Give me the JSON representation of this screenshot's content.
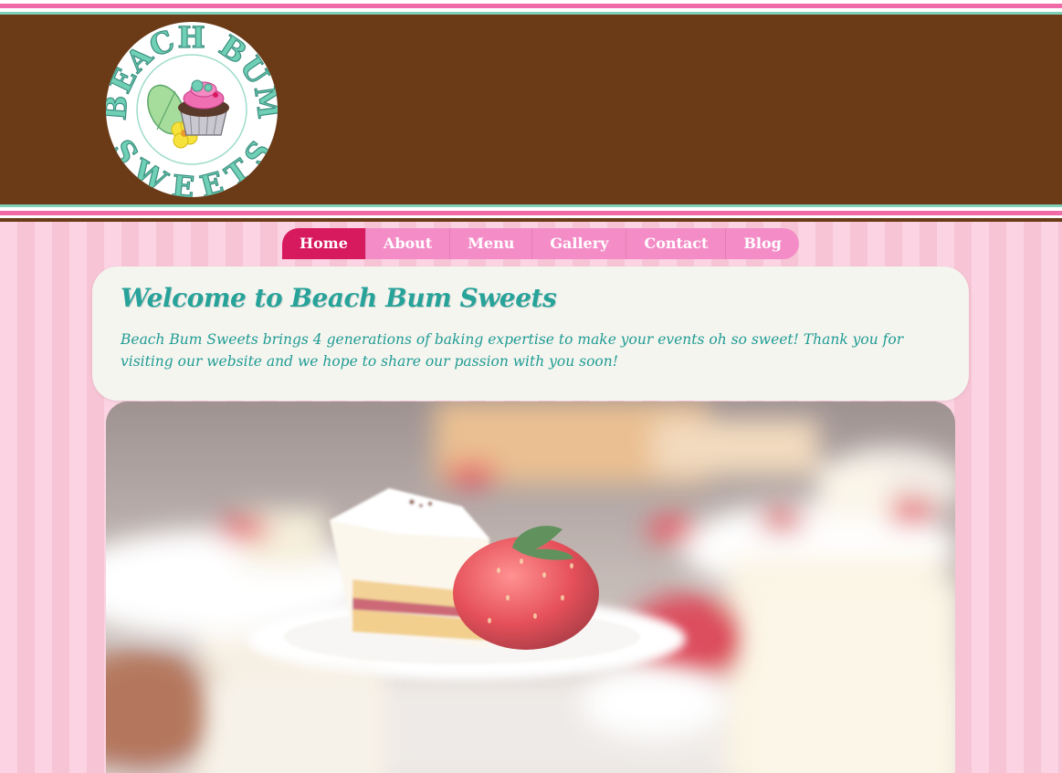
{
  "brand": {
    "logo_top_text": "BEACH BUM",
    "logo_bottom_text": "SWEETS"
  },
  "nav": {
    "items": [
      {
        "label": "Home",
        "active": true
      },
      {
        "label": "About",
        "active": false
      },
      {
        "label": "Menu",
        "active": false
      },
      {
        "label": "Gallery",
        "active": false
      },
      {
        "label": "Contact",
        "active": false
      },
      {
        "label": "Blog",
        "active": false
      }
    ]
  },
  "welcome": {
    "title": "Welcome to Beach Bum Sweets",
    "body": "Beach Bum Sweets brings 4 generations of baking expertise to make your events oh so sweet! Thank you for visiting our website and we hope to share our passion with you soon!"
  },
  "colors": {
    "header_brown": "#6b3a17",
    "accent_pink": "#f48dc7",
    "active_pink": "#d7195e",
    "teal": "#28a39a",
    "panel_bg": "#f5f5f0"
  }
}
